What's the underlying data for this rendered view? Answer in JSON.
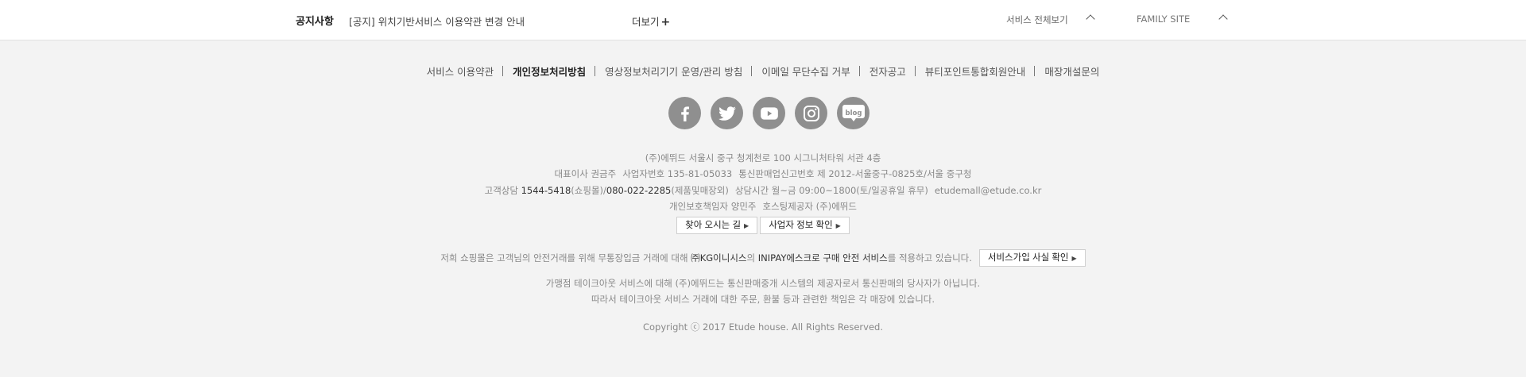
{
  "notice": {
    "title": "공지사항",
    "text": "[공지] 위치기반서비스 이용약관 변경 안내",
    "more_label": "더보기",
    "more_plus": "+"
  },
  "service_all": "서비스 전체보기",
  "family_site": "FAMILY SITE",
  "footer_links": [
    "서비스 이용약관",
    "개인정보처리방침",
    "영상정보처리기기 운영/관리 방침",
    "이메일 무단수집 거부",
    "전자공고",
    "뷰티포인트통합회원안내",
    "매장개설문의"
  ],
  "sns": {
    "blog_label": "blog"
  },
  "company": {
    "line1": "(주)에뛰드 서울시 중구 청계천로 100 시그니처타워 서관 4층",
    "ceo": "대표이사 권금주",
    "biz_no": "사업자번호 135-81-05033",
    "mail_order": "통신판매업신고번호 제 2012-서울중구-0825호/서울 중구청",
    "cs_label": "고객상담",
    "cs_phone1": "1544-5418",
    "cs_phone1_desc": "(쇼핑몰)/",
    "cs_phone2": "080-022-2285",
    "cs_phone2_desc": "(제품및매장외)",
    "hours": "상담시간 월~금 09:00~1800(토/일공휴일 휴무)",
    "email": "etudemall@etude.co.kr",
    "privacy": "개인보호책임자 양민주",
    "hosting": "호스팅제공자 (주)에뛰드"
  },
  "buttons": {
    "directions": "찾아 오시는 길",
    "biz_info": "사업자 정보 확인",
    "arrow": "▶"
  },
  "escrow": {
    "prefix": "저희 쇼핑몰은 고객님의 안전거래를 위해 무통장입금 거래에 대해",
    "kg": "㈜KG이니시스",
    "mid": "의",
    "inipay": "INIPAY에스크로 구매 안전 서비스",
    "suffix": "를 적용하고 있습니다.",
    "button": "서비스가입 사실 확인"
  },
  "disclaimer": {
    "line1": "가맹점 테이크아웃 서비스에 대해 (주)에뛰드는 통신판매중개 시스템의 제공자로서 통신판매의 당사자가 아닙니다.",
    "line2": "따라서 테이크아웃 서비스 거래에 대한 주문, 환불 등과 관련한 책임은 각 매장에 있습니다."
  },
  "copyright": "Copyright ⓒ 2017 Etude house. All Rights Reserved.",
  "colors": {
    "background": "#f3f3f3",
    "topbar": "#ffffff",
    "sns_circle": "#8f8f8f"
  }
}
